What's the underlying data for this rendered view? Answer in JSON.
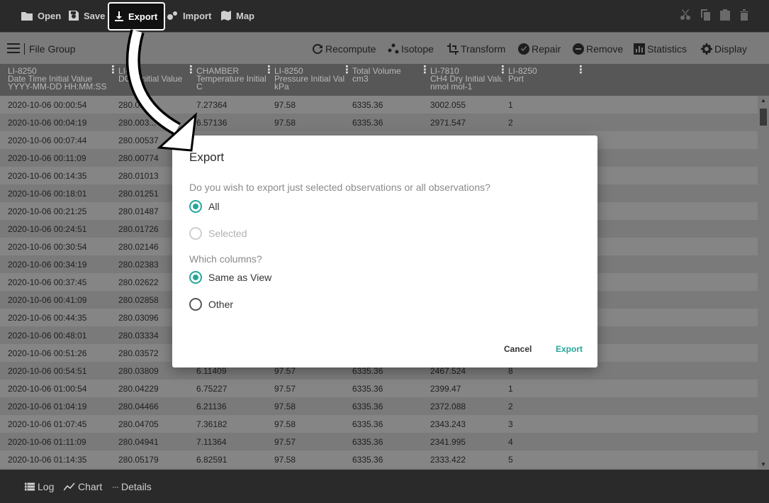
{
  "toolbar": {
    "open_label": "Open",
    "save_label": "Save",
    "export_label": "Export",
    "import_label": "Import",
    "map_label": "Map"
  },
  "toolbar2": {
    "file_group_label": "File Group",
    "recompute_label": "Recompute",
    "isotope_label": "Isotope",
    "transform_label": "Transform",
    "repair_label": "Repair",
    "remove_label": "Remove",
    "statistics_label": "Statistics",
    "display_label": "Display"
  },
  "table": {
    "headers": [
      {
        "line1": "LI-8250",
        "line2": "Date Time Initial Value",
        "line3": "YYYY-MM-DD HH:MM:SS"
      },
      {
        "line1": "LI-8...",
        "line2": "DOY Initial Value",
        "line3": ""
      },
      {
        "line1": "CHAMBER",
        "line2": "Temperature Initial",
        "line3": "C"
      },
      {
        "line1": "LI-8250",
        "line2": "Pressure Initial Val",
        "line3": "kPa"
      },
      {
        "line1": "",
        "line2": "Total Volume",
        "line3": "cm3"
      },
      {
        "line1": "LI-7810",
        "line2": "CH4 Dry Initial Valu",
        "line3": "nmol mol-1"
      },
      {
        "line1": "LI-8250",
        "line2": "Port",
        "line3": ""
      }
    ],
    "rows": [
      [
        "2020-10-06 00:00:54",
        "280.0...",
        "7.27364",
        "97.58",
        "6335.36",
        "3002.055",
        "1"
      ],
      [
        "2020-10-06 00:04:19",
        "280.003...",
        "6.57136",
        "97.58",
        "6335.36",
        "2971.547",
        "2"
      ],
      [
        "2020-10-06 00:07:44",
        "280.00537",
        "",
        "",
        "",
        "",
        ""
      ],
      [
        "2020-10-06 00:11:09",
        "280.00774",
        "",
        "",
        "",
        "",
        ""
      ],
      [
        "2020-10-06 00:14:35",
        "280.01013",
        "",
        "",
        "",
        "",
        ""
      ],
      [
        "2020-10-06 00:18:01",
        "280.01251",
        "",
        "",
        "",
        "",
        ""
      ],
      [
        "2020-10-06 00:21:25",
        "280.01487",
        "",
        "",
        "",
        "",
        ""
      ],
      [
        "2020-10-06 00:24:51",
        "280.01726",
        "",
        "",
        "",
        "",
        ""
      ],
      [
        "2020-10-06 00:30:54",
        "280.02146",
        "",
        "",
        "",
        "",
        ""
      ],
      [
        "2020-10-06 00:34:19",
        "280.02383",
        "",
        "",
        "",
        "",
        ""
      ],
      [
        "2020-10-06 00:37:45",
        "280.02622",
        "",
        "",
        "",
        "",
        ""
      ],
      [
        "2020-10-06 00:41:09",
        "280.02858",
        "",
        "",
        "",
        "",
        ""
      ],
      [
        "2020-10-06 00:44:35",
        "280.03096",
        "",
        "",
        "",
        "",
        ""
      ],
      [
        "2020-10-06 00:48:01",
        "280.03334",
        "",
        "",
        "",
        "",
        ""
      ],
      [
        "2020-10-06 00:51:26",
        "280.03572",
        "",
        "",
        "",
        "",
        ""
      ],
      [
        "2020-10-06 00:54:51",
        "280.03809",
        "6.11409",
        "97.57",
        "6335.36",
        "2467.524",
        "8"
      ],
      [
        "2020-10-06 01:00:54",
        "280.04229",
        "6.75227",
        "97.57",
        "6335.36",
        "2399.47",
        "1"
      ],
      [
        "2020-10-06 01:04:19",
        "280.04466",
        "6.21136",
        "97.58",
        "6335.36",
        "2372.088",
        "2"
      ],
      [
        "2020-10-06 01:07:45",
        "280.04705",
        "7.36182",
        "97.58",
        "6335.36",
        "2343.243",
        "3"
      ],
      [
        "2020-10-06 01:11:09",
        "280.04941",
        "7.11364",
        "97.57",
        "6335.36",
        "2341.995",
        "4"
      ],
      [
        "2020-10-06 01:14:35",
        "280.05179",
        "6.82591",
        "97.58",
        "6335.36",
        "2333.422",
        "5"
      ]
    ]
  },
  "bottom": {
    "log_label": "Log",
    "chart_label": "Chart",
    "details_label": "Details"
  },
  "dialog": {
    "title": "Export",
    "question1": "Do you wish to export just selected observations or all observations?",
    "option_all": "All",
    "option_selected": "Selected",
    "question2": "Which columns?",
    "option_same": "Same as View",
    "option_other": "Other",
    "cancel_label": "Cancel",
    "export_label": "Export"
  },
  "colors": {
    "accent": "#26a69a",
    "toolbar": "#2a2a2a",
    "header": "#575757"
  }
}
